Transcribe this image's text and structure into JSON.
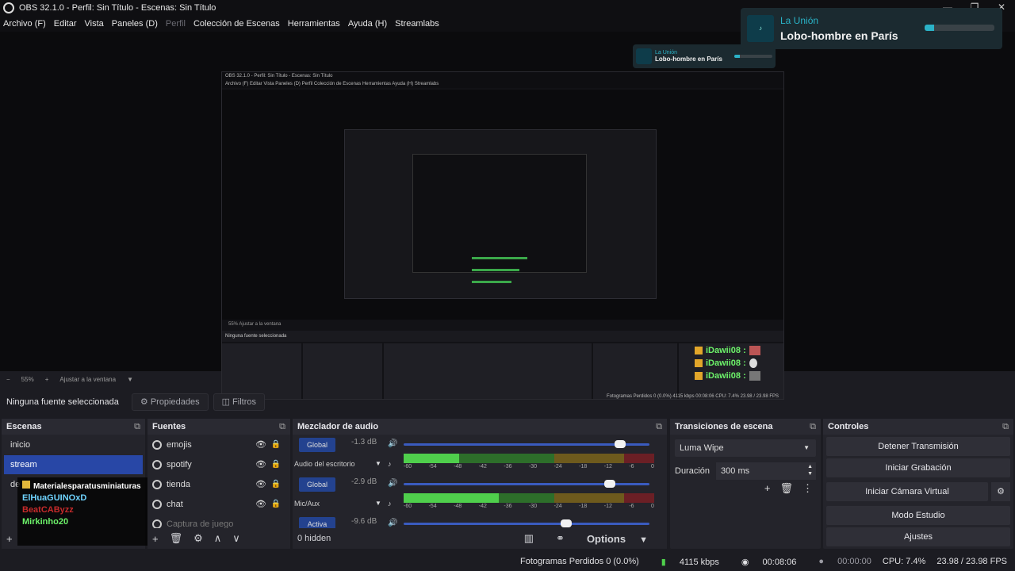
{
  "window": {
    "title": "OBS 32.1.0 - Perfil: Sin Título - Escenas: Sin Título",
    "controls": [
      "—",
      "❐",
      "✕"
    ]
  },
  "menu": [
    "Archivo (F)",
    "Editar",
    "Vista",
    "Paneles (D)",
    "Perfil",
    "Colección de Escenas",
    "Herramientas",
    "Ayuda (H)",
    "Streamlabs"
  ],
  "nowplaying": {
    "artist": "La Unión",
    "song": "Lobo-hombre en París",
    "progress": 0.14
  },
  "zoom": {
    "minus": "−",
    "level": "55%",
    "plus": "+",
    "fit": "Ajustar a la ventana",
    "caret": "▼"
  },
  "selection": {
    "none": "Ninguna fuente seleccionada",
    "properties": "Propiedades",
    "filters": "Filtros"
  },
  "scenes": {
    "title": "Escenas",
    "items": [
      "inicio",
      "stream",
      "de"
    ]
  },
  "sources": {
    "title": "Fuentes",
    "items": [
      "emojis",
      "spotify",
      "tienda",
      "chat",
      "Captura de juego"
    ]
  },
  "mixer": {
    "title": "Mezclador de audio",
    "rows": [
      {
        "button": "Global",
        "db": "-1.3 dB",
        "name": "Audio del escritorio",
        "level": 0.88
      },
      {
        "button": "Global",
        "db": "-2.9 dB",
        "name": "Mic/Aux",
        "level": 0.84
      },
      {
        "button": "Activa",
        "db": "-9.6 dB",
        "name": "",
        "level": 0.66
      }
    ],
    "ticks": [
      "-60",
      "-54",
      "-48",
      "-42",
      "-36",
      "-30",
      "-24",
      "-18",
      "-12",
      "-6",
      "0"
    ],
    "hidden": "0 hidden",
    "options": "Options"
  },
  "transitions": {
    "title": "Transiciones de escena",
    "type": "Luma Wipe",
    "duration_label": "Duración",
    "duration": "300 ms"
  },
  "controls": {
    "title": "Controles",
    "stop_stream": "Detener Transmisión",
    "start_record": "Iniciar Grabación",
    "virtual_cam": "Iniciar Cámara Virtual",
    "studio": "Modo Estudio",
    "settings": "Ajustes"
  },
  "chat_overlay": {
    "user": "iDawii08 :",
    "lines": 3
  },
  "scene_chat": {
    "folder": "Materialesparatusminiaturas",
    "lines": [
      "ElHuaGUINOxD",
      "BeatCAByzz",
      "Mirkinho20"
    ]
  },
  "status": {
    "dropped": "Fotogramas Perdidos 0 (0.0%)",
    "kbps": "4115 kbps",
    "time_live": "00:08:06",
    "time_rec": "00:00:00",
    "cpu": "CPU: 7.4%",
    "fps": "23.98 / 23.98 FPS"
  },
  "nested": {
    "title": "OBS 32.1.0 - Perfil: Sin Título - Escenas: Sin Título",
    "menu": "Archivo (F)   Editar   Vista   Paneles (D)   Perfil   Colección de Escenas   Herramientas   Ayuda (H)   Streamlabs",
    "zoom": "55%   Ajustar a la ventana",
    "none_selected": "Ninguna fuente seleccionada",
    "status": "Fotogramas Perdidos 0 (0.0%)   4115 kbps   00:08:06   CPU: 7.4%   23.98 / 23.98 FPS"
  },
  "colors": {
    "accent": "#2847a6",
    "meter_green": "#4fcf4c",
    "toast_cyan": "#2bb2c7"
  }
}
